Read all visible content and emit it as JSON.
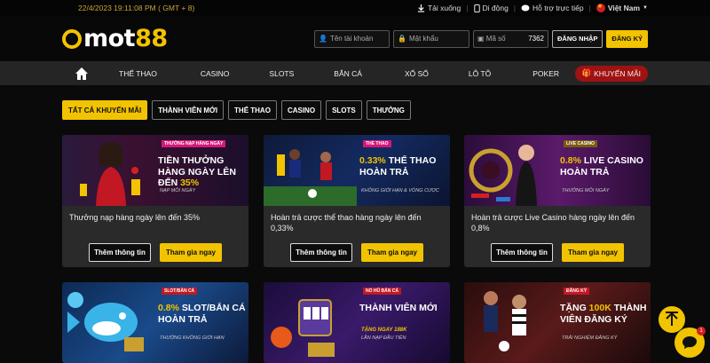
{
  "topbar": {
    "datetime": "22/4/2023 19:11:08 PM ( GMT + 8)",
    "download": "Tải xuống",
    "mobile": "Di động",
    "support": "Hỗ trợ trực tiếp",
    "language": "Việt Nam"
  },
  "header": {
    "logo_o": "O",
    "logo_text": "mot",
    "logo_num": "88",
    "username_placeholder": "Tên tài khoản",
    "password_placeholder": "Mật khẩu",
    "code_placeholder": "Mã số",
    "code_value": "7362",
    "login_label": "ĐĂNG NHẬP",
    "register_label": "ĐĂNG KÝ"
  },
  "nav": {
    "items": [
      "THỂ THAO",
      "CASINO",
      "SLOTS",
      "BẮN CÁ",
      "XỔ SỐ",
      "LÔ TÔ",
      "POKER"
    ],
    "promo": "KHUYẾN MÃI"
  },
  "filters": [
    "TẤT CẢ KHUYẾN MÃI",
    "THÀNH VIÊN MỚI",
    "THỂ THAO",
    "CASINO",
    "SLOTS",
    "THƯỞNG"
  ],
  "cards": [
    {
      "tag": "THƯỞNG NẠP HÀNG NGÀY",
      "title_a": "TIỀN THƯỞNG HÀNG NGÀY LÊN ĐẾN ",
      "title_hl": "35%",
      "sub": "NẠP MỖI NGÀY",
      "desc": "Thưởng nạp hàng ngày lên đến 35%",
      "info": "Thêm thông tin",
      "join": "Tham gia ngay"
    },
    {
      "tag": "THỂ THAO",
      "title_hl": "0.33%",
      "title_a": " THỂ THAO HOÀN TRẢ",
      "sub": "KHÔNG GIỚI HẠN & VÒNG CƯỢC",
      "desc": "Hoàn trả cược thể thao hàng ngày lên đến 0,33%",
      "info": "Thêm thông tin",
      "join": "Tham gia ngay"
    },
    {
      "tag": "LIVE CASINO",
      "title_hl": "0.8%",
      "title_a": " LIVE CASINO HOÀN TRẢ",
      "sub": "THƯỞNG MỖI NGÀY",
      "desc": "Hoàn trả cược Live Casino hàng ngày lên đến 0,8%",
      "info": "Thêm thông tin",
      "join": "Tham gia ngay"
    },
    {
      "tag": "SLOT/BẮN CÁ",
      "title_hl": "0.8%",
      "title_a": " SLOT/BẮN CÁ HOÀN TRẢ",
      "sub": "THƯỞNG KHÔNG GIỚI HẠN"
    },
    {
      "tag": "NỔ HŨ BẮN CÁ",
      "title_a": "THÀNH VIÊN MỚI",
      "sub_hl": "TẶNG NGAY 188K",
      "sub": "LẦN NẠP ĐẦU TIÊN"
    },
    {
      "tag": "ĐĂNG KÝ",
      "title_a": "TẶNG ",
      "title_hl": "100K",
      "title_b": " THÀNH VIÊN ĐĂNG KÝ",
      "sub": "TRẢI NGHIỆM ĐĂNG KÝ"
    }
  ],
  "chat": {
    "badge": "1"
  },
  "colors": {
    "accent": "#f2c300",
    "nav_bg": "#252525",
    "promo_red": "#a01212",
    "card_bg": "#2a2a2a"
  }
}
